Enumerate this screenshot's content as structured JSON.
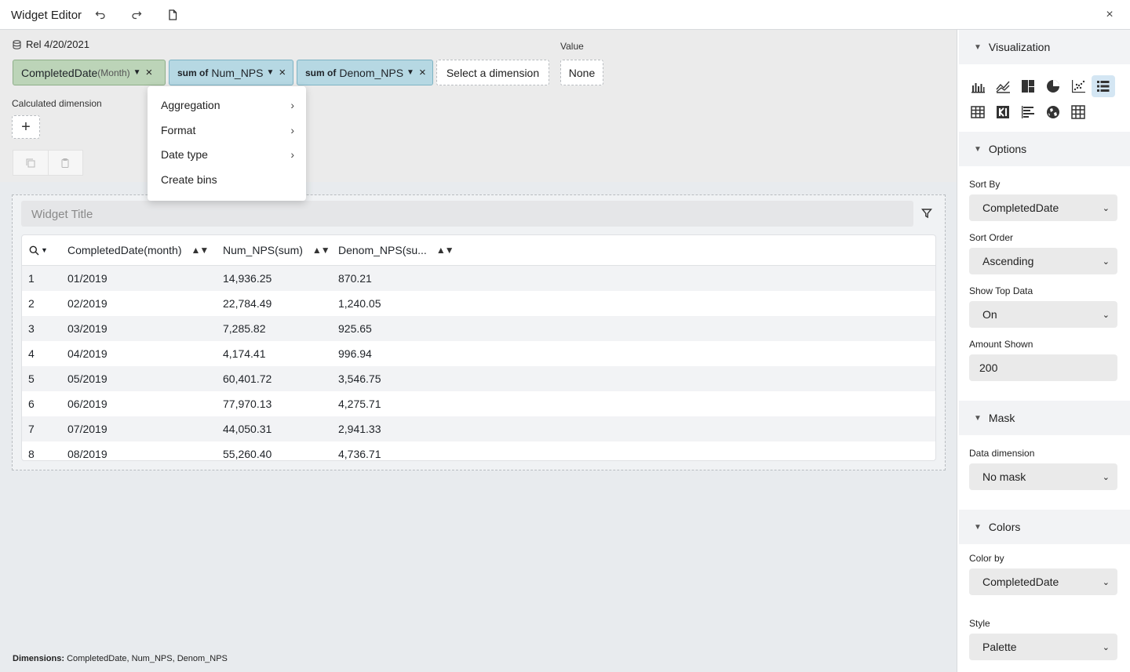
{
  "app": {
    "title": "Widget Editor"
  },
  "toolbar": {
    "undo_icon": "undo-icon",
    "redo_icon": "redo-icon",
    "save_icon": "file-icon",
    "close_label": "×"
  },
  "datasource": {
    "label": "Rel 4/20/2021"
  },
  "dimensions": {
    "chip1": {
      "label": "CompletedDate",
      "sub": "(Month)",
      "remove": "×"
    },
    "chip2": {
      "agg": "sum of",
      "label": "Num_NPS",
      "remove": "×"
    },
    "chip3": {
      "agg": "sum of",
      "label": "Denom_NPS",
      "remove": "×"
    },
    "select_placeholder": "Select a dimension"
  },
  "value": {
    "label": "Value",
    "current": "None"
  },
  "calculated": {
    "label": "Calculated dimension",
    "add": "+"
  },
  "menu": {
    "items": [
      {
        "label": "Aggregation",
        "has_sub": true
      },
      {
        "label": "Format",
        "has_sub": true
      },
      {
        "label": "Date type",
        "has_sub": true
      },
      {
        "label": "Create bins",
        "has_sub": false
      }
    ]
  },
  "widget": {
    "title_placeholder": "Widget Title"
  },
  "table": {
    "columns": [
      "CompletedDate(month)",
      "Num_NPS(sum)",
      "Denom_NPS(su..."
    ],
    "rows": [
      [
        "1",
        "01/2019",
        "14,936.25",
        "870.21"
      ],
      [
        "2",
        "02/2019",
        "22,784.49",
        "1,240.05"
      ],
      [
        "3",
        "03/2019",
        "7,285.82",
        "925.65"
      ],
      [
        "4",
        "04/2019",
        "4,174.41",
        "996.94"
      ],
      [
        "5",
        "05/2019",
        "60,401.72",
        "3,546.75"
      ],
      [
        "6",
        "06/2019",
        "77,970.13",
        "4,275.71"
      ],
      [
        "7",
        "07/2019",
        "44,050.31",
        "2,941.33"
      ],
      [
        "8",
        "08/2019",
        "55,260.40",
        "4,736.71"
      ]
    ]
  },
  "footer": {
    "label": "Dimensions:",
    "value": "CompletedDate, Num_NPS, Denom_NPS"
  },
  "panel": {
    "visualization": {
      "title": "Visualization",
      "icons": [
        "bar-chart-icon",
        "line-chart-icon",
        "treemap-icon",
        "pie-chart-icon",
        "scatter-chart-icon",
        "list-icon",
        "table-icon",
        "kpi-icon",
        "horizontal-bar-icon",
        "map-icon",
        "pivot-table-icon"
      ],
      "selected": "list-icon"
    },
    "options": {
      "title": "Options",
      "sort_by_label": "Sort By",
      "sort_by": "CompletedDate",
      "sort_order_label": "Sort Order",
      "sort_order": "Ascending",
      "show_top_label": "Show Top Data",
      "show_top": "On",
      "amount_label": "Amount Shown",
      "amount": "200"
    },
    "mask": {
      "title": "Mask",
      "data_dim_label": "Data dimension",
      "data_dim": "No mask"
    },
    "colors": {
      "title": "Colors",
      "color_by_label": "Color by",
      "color_by": "CompletedDate",
      "style_label": "Style",
      "style": "Palette"
    }
  },
  "colors": {
    "dimension_chip": "#bcd4b8",
    "measure_chip": "#b6d8e3",
    "selected_vis": "#d4e6f3"
  }
}
